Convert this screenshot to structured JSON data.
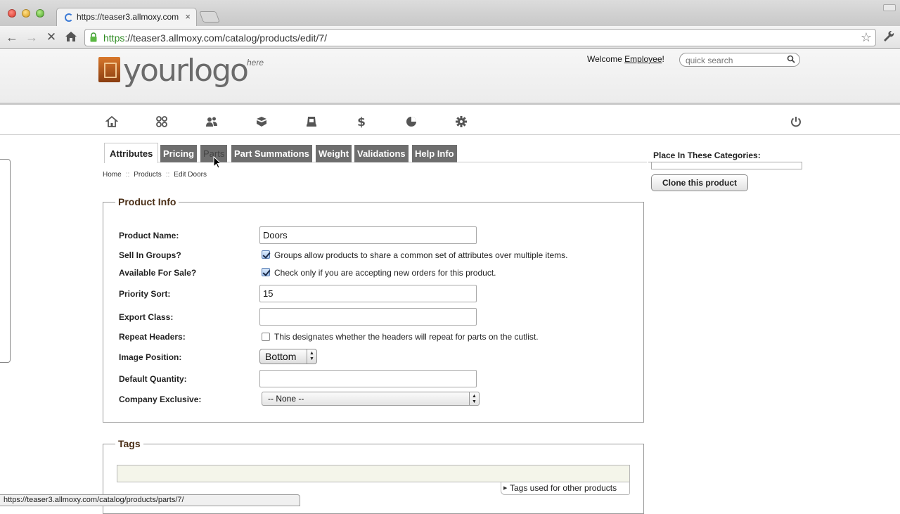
{
  "browser": {
    "tab_title": "https://teaser3.allmoxy.com",
    "tab_close": "×",
    "url_scheme": "https",
    "url_rest": "://teaser3.allmoxy.com/catalog/products/edit/7/",
    "status_url": "https://teaser3.allmoxy.com/catalog/products/parts/7/"
  },
  "header": {
    "logo_text": "yourlogo",
    "logo_sup": "here",
    "welcome_prefix": "Welcome ",
    "welcome_user": "Employee",
    "welcome_suffix": "!",
    "search_placeholder": "quick search"
  },
  "nav_icons": [
    "home-icon",
    "grid-icon",
    "users-icon",
    "box-icon",
    "printer-icon",
    "dollar-icon",
    "pie-chart-icon",
    "settings-gear-icon",
    "power-icon"
  ],
  "tabs": {
    "attributes": "Attributes",
    "pricing": "Pricing",
    "parts": "Parts",
    "part_summations": "Part Summations",
    "weight": "Weight",
    "validations": "Validations",
    "help_info": "Help Info"
  },
  "breadcrumb": {
    "home": "Home",
    "products": "Products",
    "current": "Edit Doors",
    "sep": "::"
  },
  "product_info": {
    "legend": "Product Info",
    "name_label": "Product Name:",
    "name_value": "Doors",
    "groups_label": "Sell In Groups?",
    "groups_hint": "Groups allow products to share a common set of attributes over multiple items.",
    "groups_checked": true,
    "sale_label": "Available For Sale?",
    "sale_hint": "Check only if you are accepting new orders for this product.",
    "sale_checked": true,
    "priority_label": "Priority Sort:",
    "priority_value": "15",
    "export_label": "Export Class:",
    "export_value": "",
    "repeat_label": "Repeat Headers:",
    "repeat_hint": "This designates whether the headers will repeat for parts on the cutlist.",
    "repeat_checked": false,
    "image_pos_label": "Image Position:",
    "image_pos_value": "Bottom",
    "default_qty_label": "Default Quantity:",
    "default_qty_value": "",
    "company_label": "Company Exclusive:",
    "company_value": "-- None --"
  },
  "tags": {
    "legend": "Tags",
    "other_link": "Tags used for other products"
  },
  "right_panel": {
    "categories_title": "Place In These Categories:",
    "clone_button": "Clone this product"
  }
}
